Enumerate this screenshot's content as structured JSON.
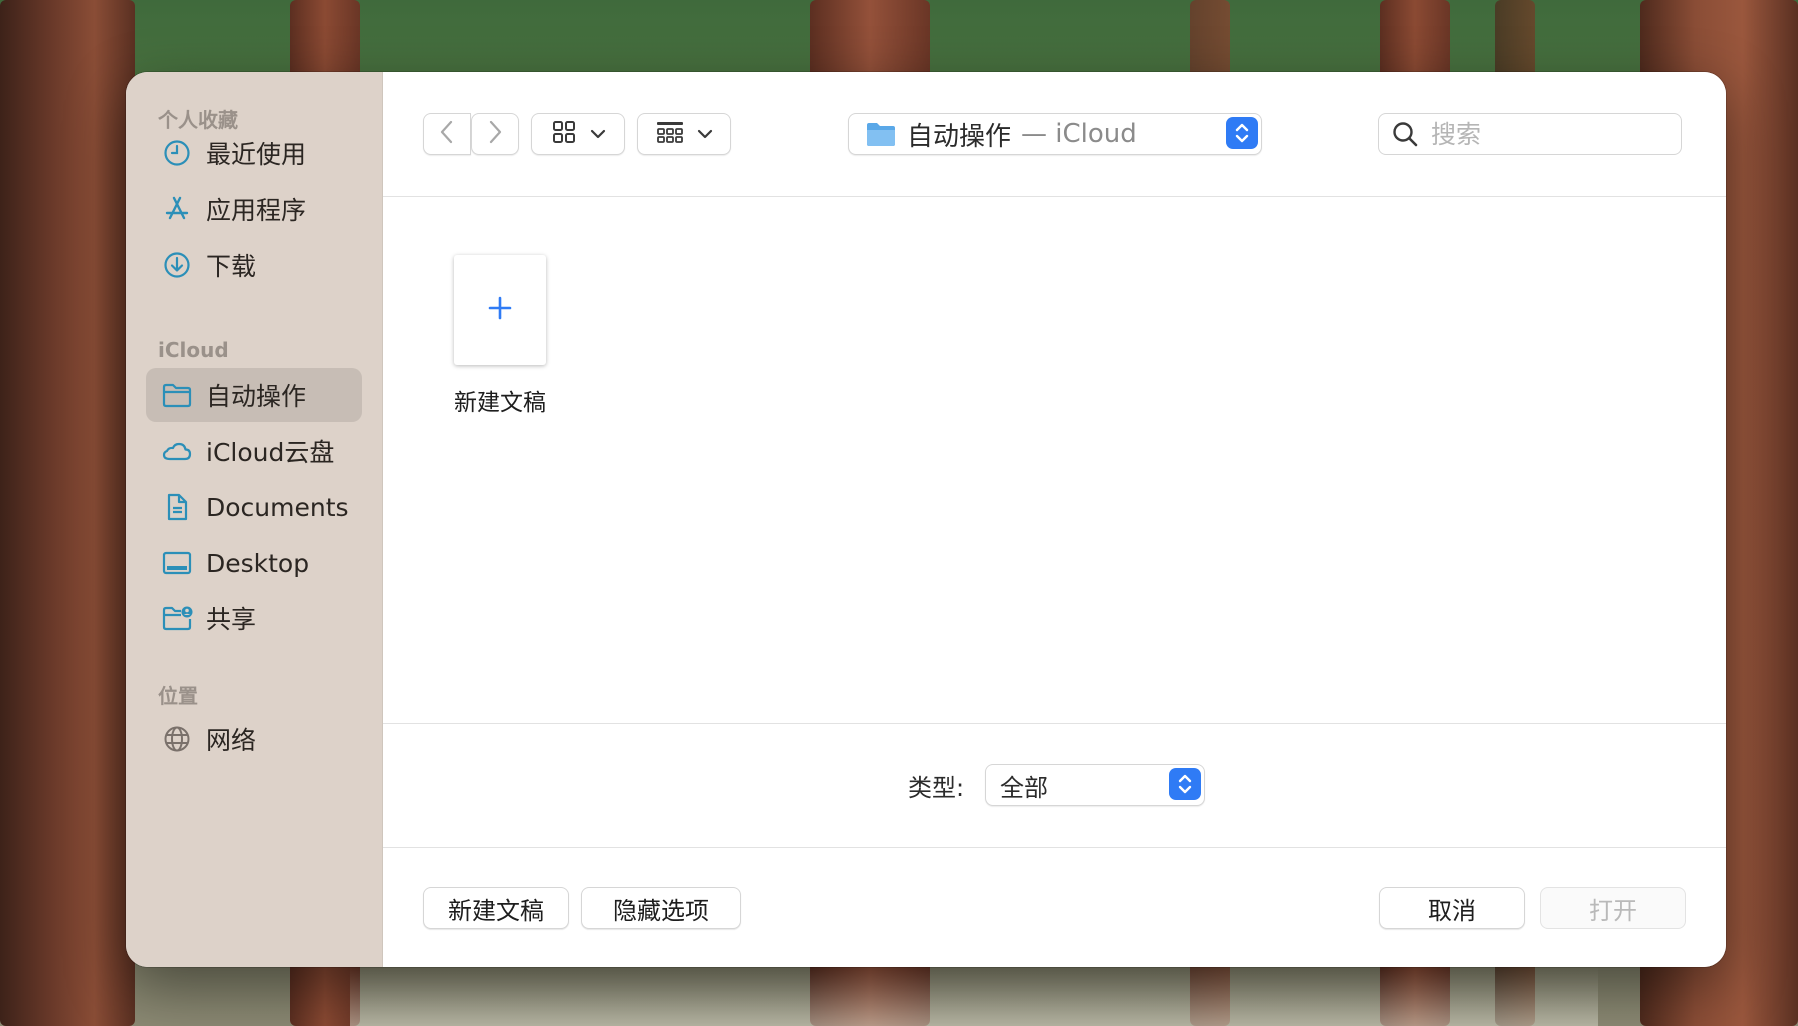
{
  "sidebar": {
    "sections": [
      {
        "title": "个人收藏",
        "items": [
          {
            "label": "最近使用",
            "icon": "clock-icon"
          },
          {
            "label": "应用程序",
            "icon": "app-store-icon"
          },
          {
            "label": "下载",
            "icon": "download-icon"
          }
        ]
      },
      {
        "title": "iCloud",
        "items": [
          {
            "label": "自动操作",
            "icon": "folder-icon",
            "selected": true
          },
          {
            "label": "iCloud云盘",
            "icon": "cloud-icon"
          },
          {
            "label": "Documents",
            "icon": "document-icon"
          },
          {
            "label": "Desktop",
            "icon": "desktop-icon"
          },
          {
            "label": "共享",
            "icon": "shared-folder-icon"
          }
        ]
      },
      {
        "title": "位置",
        "items": [
          {
            "label": "网络",
            "icon": "globe-icon"
          }
        ]
      }
    ]
  },
  "toolbar": {
    "back_icon": "chevron-left-icon",
    "forward_icon": "chevron-right-icon",
    "view_icon": "grid-icon",
    "group_icon": "gallery-grid-icon",
    "path": {
      "folder": "自动操作",
      "separator": "— iCloud",
      "icon": "folder-icon"
    },
    "search_placeholder": "搜索"
  },
  "content": {
    "items": [
      {
        "label": "新建文稿",
        "icon": "plus-icon"
      }
    ]
  },
  "filter": {
    "label": "类型:",
    "value": "全部"
  },
  "actions": {
    "new_document": "新建文稿",
    "hide_options": "隐藏选项",
    "cancel": "取消",
    "open": "打开"
  },
  "colors": {
    "accent": "#2f7bf5",
    "sidebar_bg": "#ddd2c9",
    "sidebar_selected": "#c7bdb5",
    "icon_teal": "#2b8fb8"
  }
}
